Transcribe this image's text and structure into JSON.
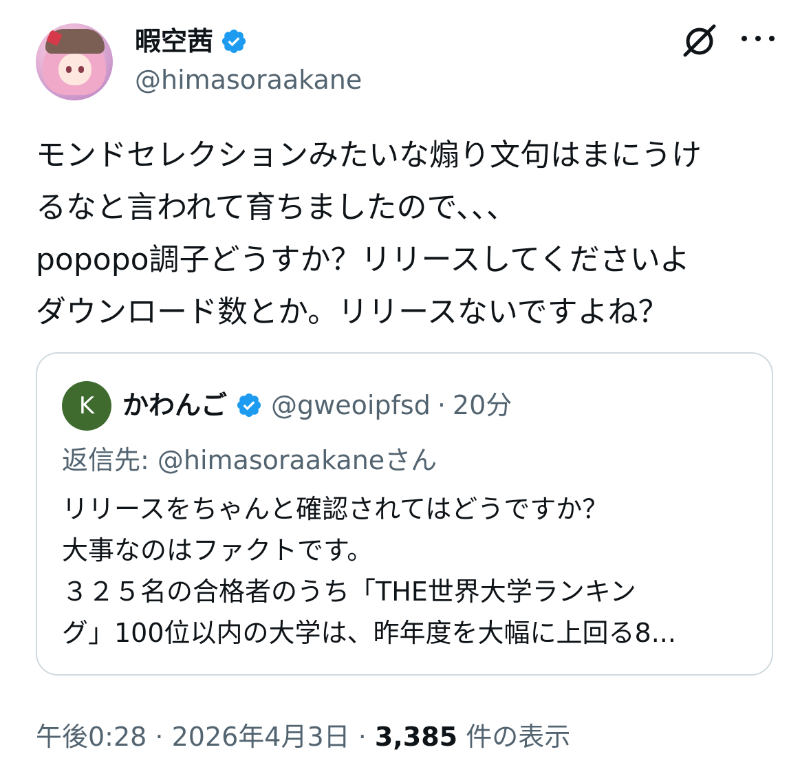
{
  "author": {
    "display_name": "暇空茜",
    "handle": "@himasoraakane",
    "verified": true,
    "avatar_icon": "anime-avatar"
  },
  "header_icons": {
    "grok": "grok-icon",
    "more": "more-icon"
  },
  "tweet": {
    "lines": [
      "モンドセレクションみたいな煽り文句はまにうけ",
      "るなと言われて育ちましたので、、、",
      "popopo調子どうすか？リリースしてくださいよ",
      "ダウンロード数とか。リリースないですよね？"
    ]
  },
  "quote": {
    "avatar_letter": "K",
    "name": "かわんご",
    "verified": true,
    "handle": "@gweoipfsd",
    "separator": "·",
    "time": "20分",
    "reply_to": "返信先: @himasoraakaneさん",
    "lines": [
      "リリースをちゃんと確認されてはどうですか？",
      "大事なのはファクトです。",
      "３２５名の合格者のうち「THE世界大学ランキン",
      "グ」100位以内の大学は、昨年度を大幅に上回る8..."
    ]
  },
  "meta": {
    "time": "午後0:28",
    "sep1": " · ",
    "date": "2026年4月3日",
    "sep2": " · ",
    "views_count": "3,385",
    "views_label": " 件の表示"
  },
  "colors": {
    "text": "#0f1419",
    "secondary": "#536471",
    "verified_blue": "#1d9bf0",
    "border": "#cfd9de",
    "quote_avatar": "#3f6b2f"
  }
}
